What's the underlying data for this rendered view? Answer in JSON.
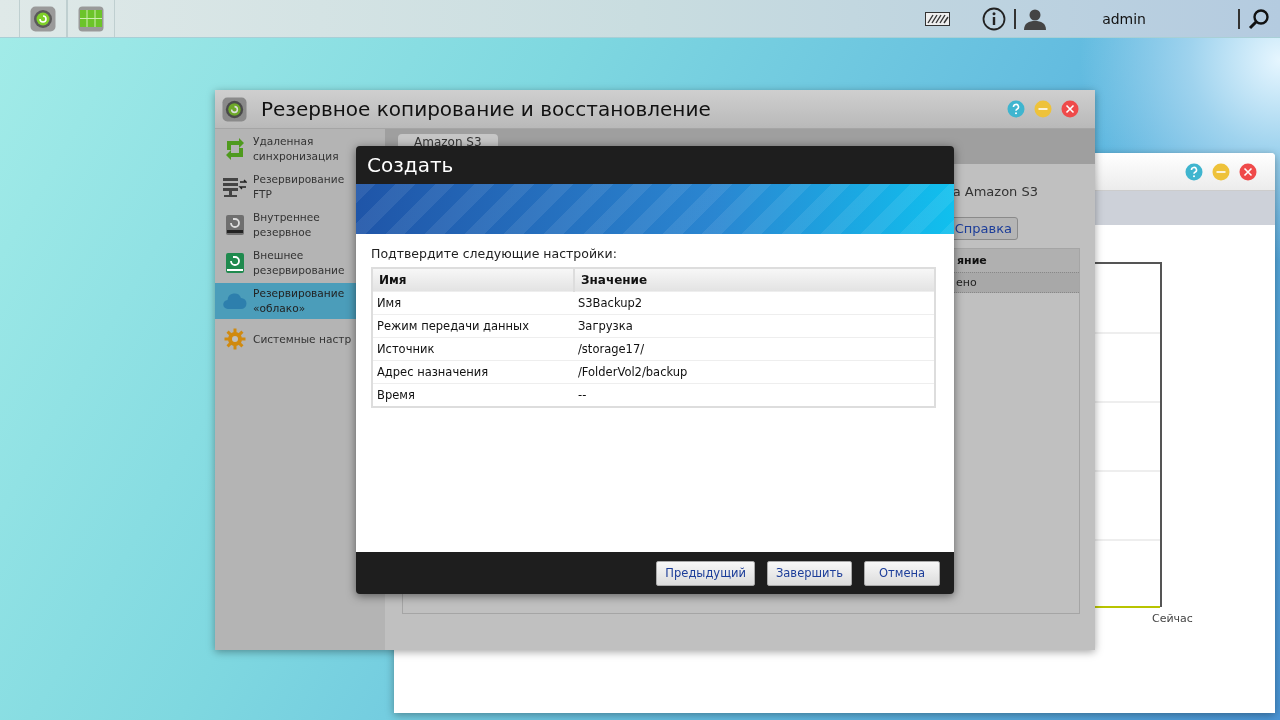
{
  "top_bar": {
    "user": "admin"
  },
  "back_window": {
    "chart_label": "Сейчас"
  },
  "main_window": {
    "title": "Резервное копирование и восстановление",
    "sidebar": {
      "items": [
        {
          "lines": [
            "Удаленная",
            "синхронизация"
          ],
          "selected": false
        },
        {
          "lines": [
            "Резервирование",
            "FTP"
          ],
          "selected": false
        },
        {
          "lines": [
            "Внутреннее",
            "резервное"
          ],
          "selected": false
        },
        {
          "lines": [
            "Внешнее",
            "резервирование"
          ],
          "selected": false
        },
        {
          "lines": [
            "Резервирование",
            "«облако»"
          ],
          "selected": true
        },
        {
          "lines": [
            "Системные настр"
          ],
          "selected": false
        }
      ]
    },
    "tabs": [
      {
        "label": "Amazon S3",
        "selected": true
      }
    ],
    "description": "a Amazon S3",
    "help_button": "Справка",
    "table": {
      "columns": [
        "яние"
      ],
      "rows": [
        [
          "ено"
        ]
      ]
    }
  },
  "dialog": {
    "title": "Создать",
    "prompt": "Подтвердите следующие настройки:",
    "table": {
      "columns": [
        "Имя",
        "Значение"
      ],
      "rows": [
        [
          "Имя",
          "S3Backup2"
        ],
        [
          "Режим передачи данных",
          "Загрузка"
        ],
        [
          "Источник",
          "/storage17/"
        ],
        [
          "Адрес назначения",
          "/FolderVol2/backup"
        ],
        [
          "Время",
          "--"
        ]
      ]
    },
    "buttons": [
      "Предыдущий",
      "Завершить",
      "Отмена"
    ]
  }
}
